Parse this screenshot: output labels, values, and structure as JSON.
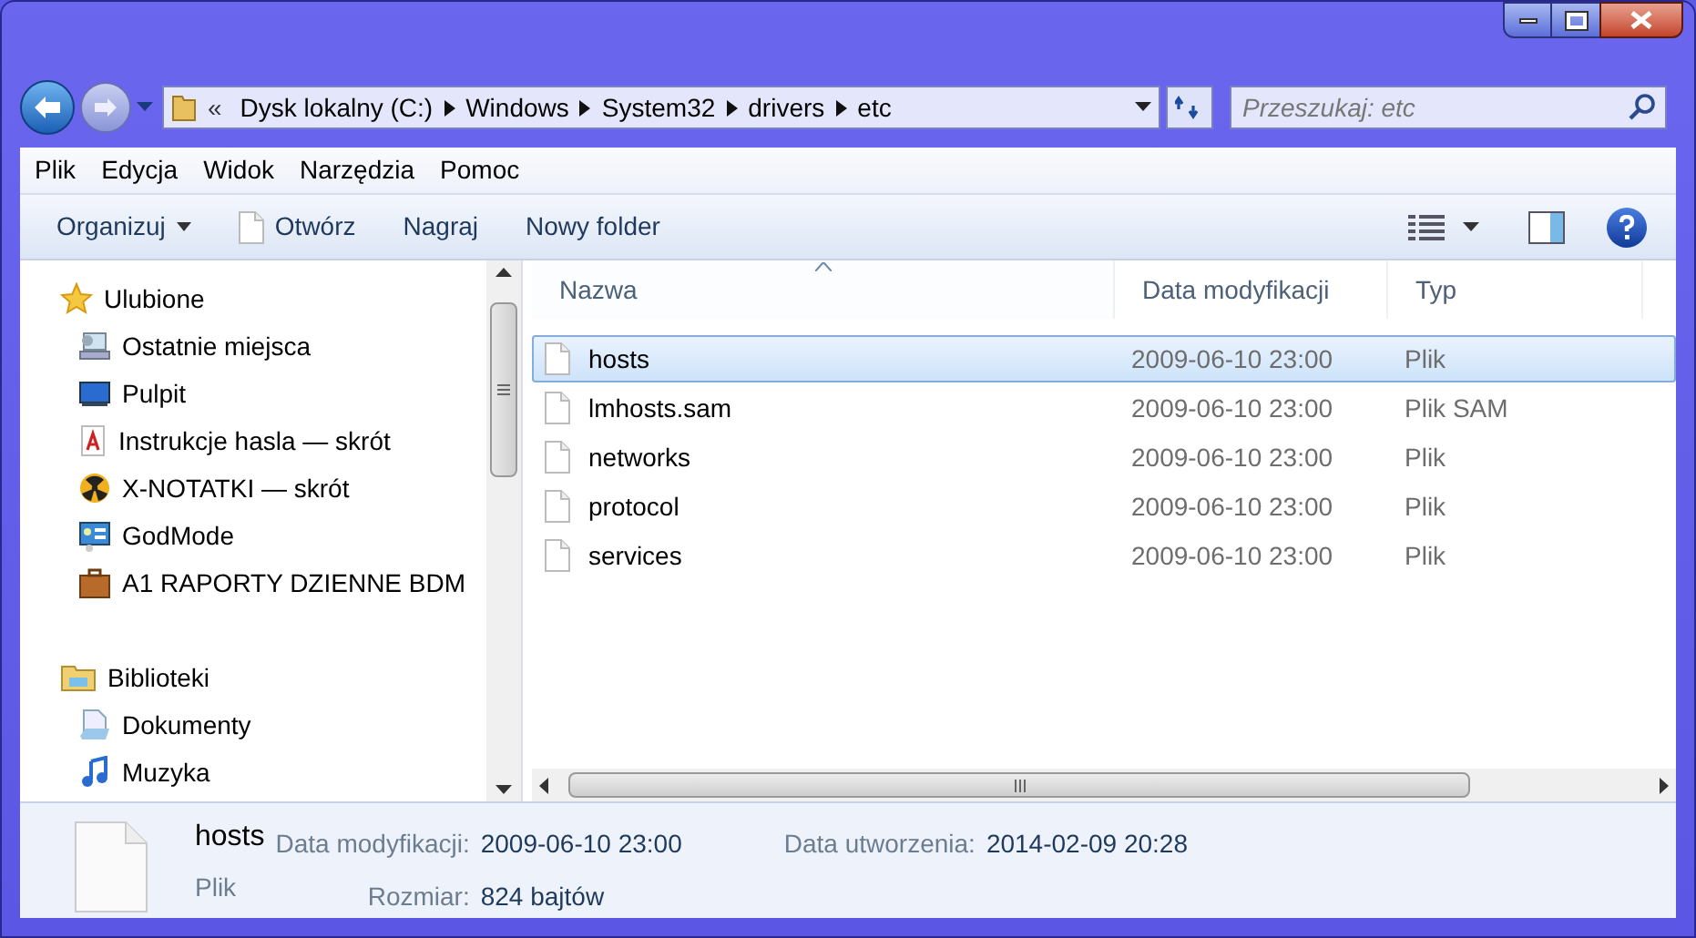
{
  "address": {
    "overflow": "«",
    "segments": [
      "Dysk lokalny (C:)",
      "Windows",
      "System32",
      "drivers",
      "etc"
    ]
  },
  "search": {
    "placeholder": "Przeszukaj: etc"
  },
  "menu": [
    "Plik",
    "Edycja",
    "Widok",
    "Narzędzia",
    "Pomoc"
  ],
  "toolbar": [
    {
      "label": "Organizuj",
      "kind": "dropdown"
    },
    {
      "label": "Otwórz",
      "kind": "open"
    },
    {
      "label": "Nagraj",
      "kind": "plain"
    },
    {
      "label": "Nowy folder",
      "kind": "plain"
    }
  ],
  "sidebar": [
    {
      "label": "Ulubione",
      "children": [
        {
          "label": "Ostatnie miejsca"
        },
        {
          "label": "Pulpit"
        },
        {
          "label": "Instrukcje hasla — skrót"
        },
        {
          "label": "X-NOTATKI — skrót"
        },
        {
          "label": "GodMode"
        },
        {
          "label": "A1 RAPORTY  DZIENNE BDM"
        }
      ]
    },
    {
      "label": "Biblioteki",
      "children": [
        {
          "label": "Dokumenty"
        },
        {
          "label": "Muzyka"
        }
      ]
    }
  ],
  "table": {
    "columns": [
      {
        "label": "Nazwa",
        "sorted": true
      },
      {
        "label": "Data modyfikacji",
        "sorted": false
      },
      {
        "label": "Typ",
        "sorted": false
      }
    ],
    "rows": [
      {
        "name": "hosts",
        "modified": "2009-06-10 23:00",
        "type": "Plik",
        "selected": true
      },
      {
        "name": "lmhosts.sam",
        "modified": "2009-06-10 23:00",
        "type": "Plik SAM",
        "selected": false
      },
      {
        "name": "networks",
        "modified": "2009-06-10 23:00",
        "type": "Plik",
        "selected": false
      },
      {
        "name": "protocol",
        "modified": "2009-06-10 23:00",
        "type": "Plik",
        "selected": false
      },
      {
        "name": "services",
        "modified": "2009-06-10 23:00",
        "type": "Plik",
        "selected": false
      }
    ]
  },
  "details": {
    "name": "hosts",
    "type": "Plik",
    "fields": [
      {
        "label": "Data modyfikacji:",
        "value": "2009-06-10 23:00"
      },
      {
        "label": "Rozmiar:",
        "value": "824 bajtów"
      },
      {
        "label": "Data utworzenia:",
        "value": "2014-02-09 20:28"
      }
    ]
  }
}
